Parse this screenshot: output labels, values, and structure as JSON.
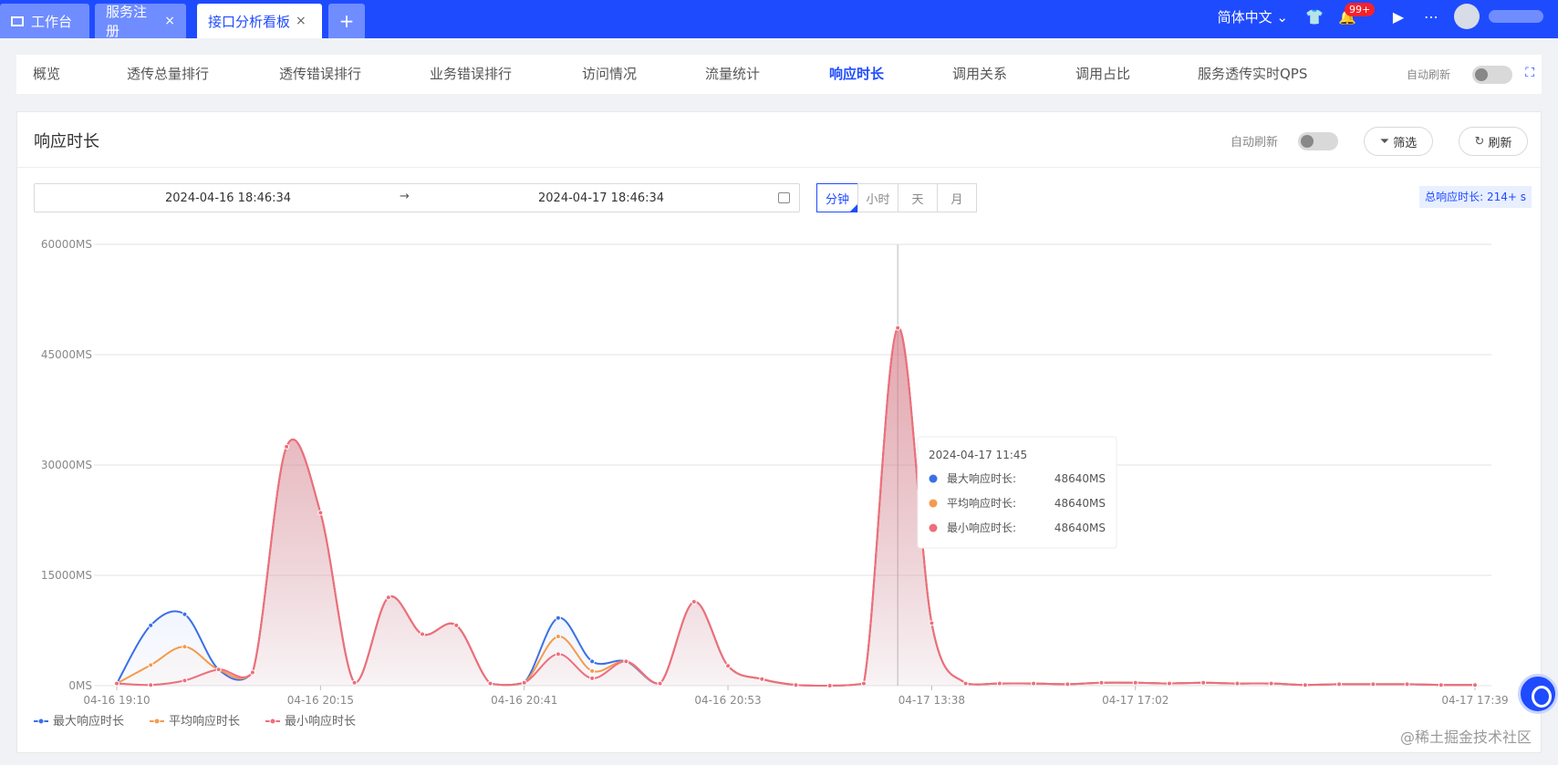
{
  "tabs": [
    {
      "label": "工作台",
      "icon": "monitor-icon"
    },
    {
      "label": "服务注册",
      "close": "×"
    },
    {
      "label": "接口分析看板",
      "close": "×"
    },
    {
      "label": "+"
    }
  ],
  "topright": {
    "language": "简体中文",
    "notifications": "99+"
  },
  "nav": {
    "items": [
      "概览",
      "透传总量排行",
      "透传错误排行",
      "业务错误排行",
      "访问情况",
      "流量统计",
      "响应时长",
      "调用关系",
      "调用占比",
      "服务透传实时QPS"
    ],
    "active": "响应时长",
    "auto_refresh": "自动刷新"
  },
  "panel": {
    "title": "响应时长",
    "auto_refresh": "自动刷新",
    "filter": "筛选",
    "refresh": "刷新",
    "date_start": "2024-04-16 18:46:34",
    "date_arrow": "→",
    "date_end": "2024-04-17 18:46:34",
    "granularity": [
      "分钟",
      "小时",
      "天",
      "月"
    ],
    "granularity_selected": "分钟",
    "total": "总响应时长: 214+ s"
  },
  "colors": {
    "accent": "#1f4bff",
    "max": "#3b6fe6",
    "avg": "#f59a4d",
    "min": "#ee6e7b"
  },
  "chart_data": {
    "type": "area",
    "y_ticks": [
      "0MS",
      "15000MS",
      "30000MS",
      "45000MS",
      "60000MS"
    ],
    "ylim": [
      0,
      60000
    ],
    "x_tick_labels": [
      "04-16 19:10",
      "04-16 20:15",
      "04-16 20:41",
      "04-16 20:53",
      "04-17 13:38",
      "04-17 17:02",
      "04-17 17:39"
    ],
    "series": [
      {
        "name": "最大响应时长",
        "color": "#3b6fe6",
        "values": [
          300,
          8200,
          9700,
          2200,
          1800,
          32500,
          23500,
          400,
          12000,
          7000,
          8200,
          300,
          400,
          9200,
          3300,
          3300,
          300,
          11400,
          2700,
          900,
          100,
          0,
          300,
          48640,
          8500,
          300,
          300,
          300,
          200,
          400,
          400,
          300,
          400,
          300,
          300,
          100,
          200,
          200,
          200,
          100,
          100
        ]
      },
      {
        "name": "平均响应时长",
        "color": "#f59a4d",
        "values": [
          300,
          2800,
          5300,
          2200,
          1800,
          32500,
          23500,
          400,
          12000,
          7000,
          8200,
          300,
          400,
          6700,
          2000,
          3300,
          300,
          11400,
          2700,
          900,
          100,
          0,
          300,
          48640,
          8500,
          300,
          300,
          300,
          200,
          400,
          400,
          300,
          400,
          300,
          300,
          100,
          200,
          200,
          200,
          100,
          100
        ]
      },
      {
        "name": "最小响应时长",
        "color": "#ee6e7b",
        "values": [
          300,
          100,
          700,
          2200,
          1800,
          32500,
          23500,
          400,
          12000,
          7000,
          8200,
          300,
          400,
          4300,
          1000,
          3300,
          300,
          11400,
          2700,
          900,
          100,
          0,
          300,
          48640,
          8500,
          300,
          300,
          300,
          200,
          400,
          400,
          300,
          400,
          300,
          300,
          100,
          200,
          200,
          200,
          100,
          100
        ]
      }
    ],
    "tooltip": {
      "title": "2024-04-17 11:45",
      "rows": [
        {
          "name": "最大响应时长:",
          "value": "48640MS"
        },
        {
          "name": "平均响应时长:",
          "value": "48640MS"
        },
        {
          "name": "最小响应时长:",
          "value": "48640MS"
        }
      ]
    },
    "legend": [
      "最大响应时长",
      "平均响应时长",
      "最小响应时长"
    ]
  },
  "watermark": "@稀土掘金技术社区"
}
